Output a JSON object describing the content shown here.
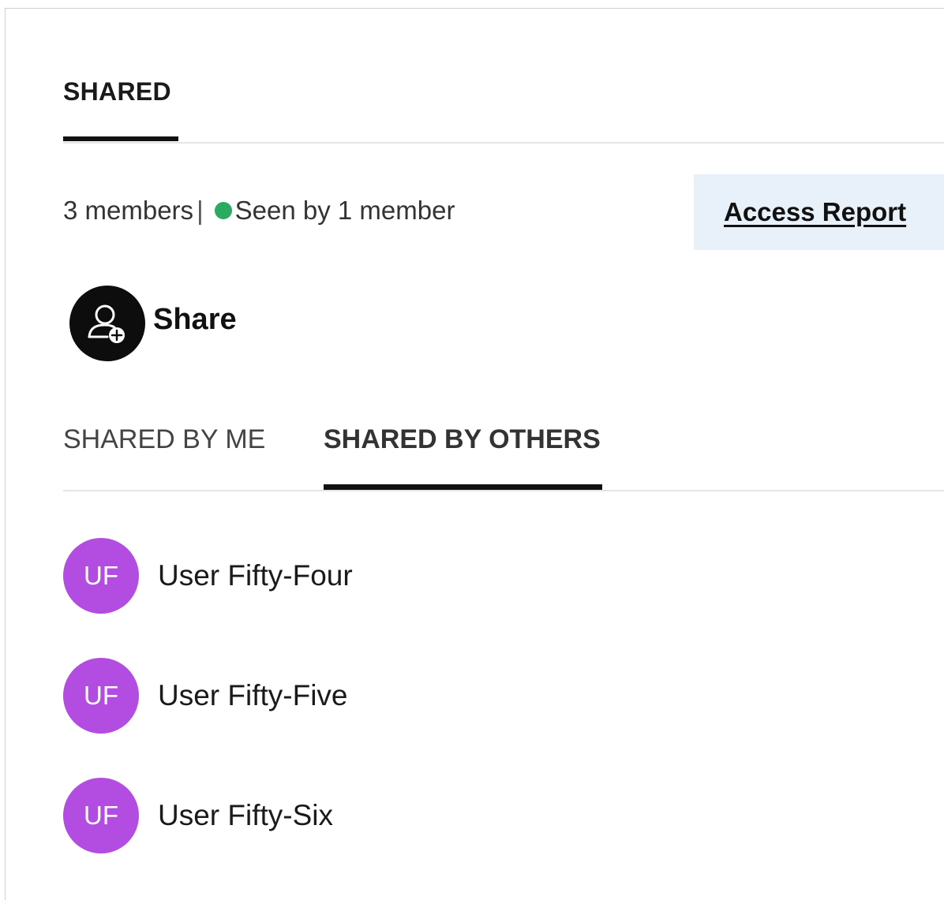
{
  "header": {
    "tab_label": "SHARED"
  },
  "summary": {
    "members_text": "3 members",
    "separator": "|",
    "seen_text": "Seen by 1 member",
    "seen_dot_color": "#2aab5f"
  },
  "access_report": {
    "label": "Access Report"
  },
  "share": {
    "label": "Share",
    "icon": "add-user-icon"
  },
  "subtabs": [
    {
      "label": "SHARED BY ME",
      "active": false
    },
    {
      "label": "SHARED BY OTHERS",
      "active": true
    }
  ],
  "members": [
    {
      "initials": "UF",
      "name": "User Fifty-Four"
    },
    {
      "initials": "UF",
      "name": "User Fifty-Five"
    },
    {
      "initials": "UF",
      "name": "User Fifty-Six"
    }
  ],
  "colors": {
    "avatar_bg": "#b34ce0",
    "access_report_bg": "#e8f0f9"
  }
}
